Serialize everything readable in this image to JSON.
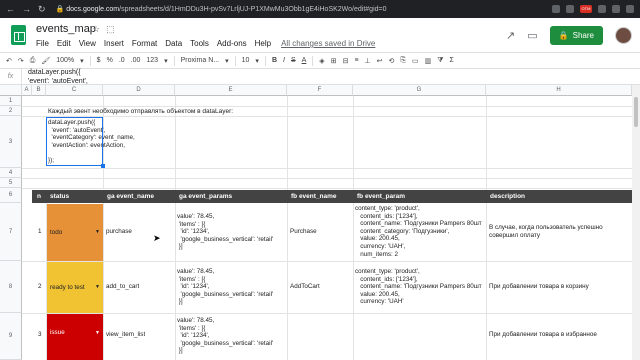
{
  "browser": {
    "url_host": "docs.google.com",
    "url_path": "/spreadsheets/d/1HmDDu3H-pvSv7LrljUJ-P1XMwMu3Obb1gE4iHoSK2Wo/edit#gid=0",
    "ext_badge": "OTM"
  },
  "doc": {
    "title": "events_map",
    "menus": [
      "File",
      "Edit",
      "View",
      "Insert",
      "Format",
      "Data",
      "Tools",
      "Add-ons",
      "Help"
    ],
    "save_status": "All changes saved in Drive",
    "share_label": "Share"
  },
  "toolbar": {
    "zoom": "100%",
    "currency": "$",
    "percent": "%",
    "dec_dec": ".0",
    "dec_inc": ".00",
    "format_more": "123",
    "font": "Proxima N...",
    "font_size": "10",
    "bold": "B",
    "italic": "I",
    "strike": "S",
    "text_color": "A"
  },
  "formula": {
    "fx": "fx",
    "line1": "dataLayer.push({",
    "line2": "'event': 'autoEvent',"
  },
  "columns": [
    "A",
    "B",
    "C",
    "D",
    "E",
    "F",
    "G",
    "H"
  ],
  "rows": [
    "1",
    "2",
    "3",
    "4",
    "5",
    "6",
    "7",
    "8",
    "9"
  ],
  "sheet": {
    "note": "Каждый эвент необходимо отправлять объектом в dataLayer:",
    "code": "dataLayer.push({\n  'event': 'autoEvent',\n  'eventCategory': event_name,\n  'eventAction': eventAction,\n\n});",
    "headers": {
      "n": "n",
      "status": "status",
      "ga_event_name": "ga event_name",
      "ga_event_params": "ga event_params",
      "fb_event_name": "fb event_name",
      "fb_event_param": "fb event_param",
      "description": "description"
    },
    "events": [
      {
        "n": "1",
        "status": "todo",
        "status_color": "#e69138",
        "ga_event_name": "purchase",
        "ga_event_params": "value': 78.45,\n 'items' : [{\n  'id': '1234',\n  'google_business_vertical': 'retail'\n }]",
        "fb_event_name": "Purchase",
        "fb_event_param": "content_type: 'product',\n   content_ids: ['1234'],\n   content_name: 'Подгузники Pampers 80шт\n   content_category: 'Подгузники',\n   value: 200.45,\n   currency: 'UAH',\n   num_items: 2",
        "description": "В случае, когда пользователь успешно\nсовершил оплату"
      },
      {
        "n": "2",
        "status": "ready to test",
        "status_color": "#f1c232",
        "ga_event_name": "add_to_cart",
        "ga_event_params": "value': 78.45,\n 'items' : [{\n  'id': '1234',\n  'google_business_vertical': 'retail'\n }]",
        "fb_event_name": "AddToCart",
        "fb_event_param": "content_type: 'product',\n   content_ids: ['1234'],\n   content_name: 'Подгузники Pampers 80шт\n   value: 200.45,\n   currency: 'UAH'",
        "description": "При добавлении товара в корзину"
      },
      {
        "n": "3",
        "status": "issue",
        "status_color": "#cc0000",
        "ga_event_name": "view_item_list",
        "ga_event_params": "value': 78.45,\n 'items' : [{\n  'id': '1234',\n  'google_business_vertical': 'retail'\n }]",
        "fb_event_name": "",
        "fb_event_param": "",
        "description": "При добавлении товара в избранное"
      }
    ]
  }
}
